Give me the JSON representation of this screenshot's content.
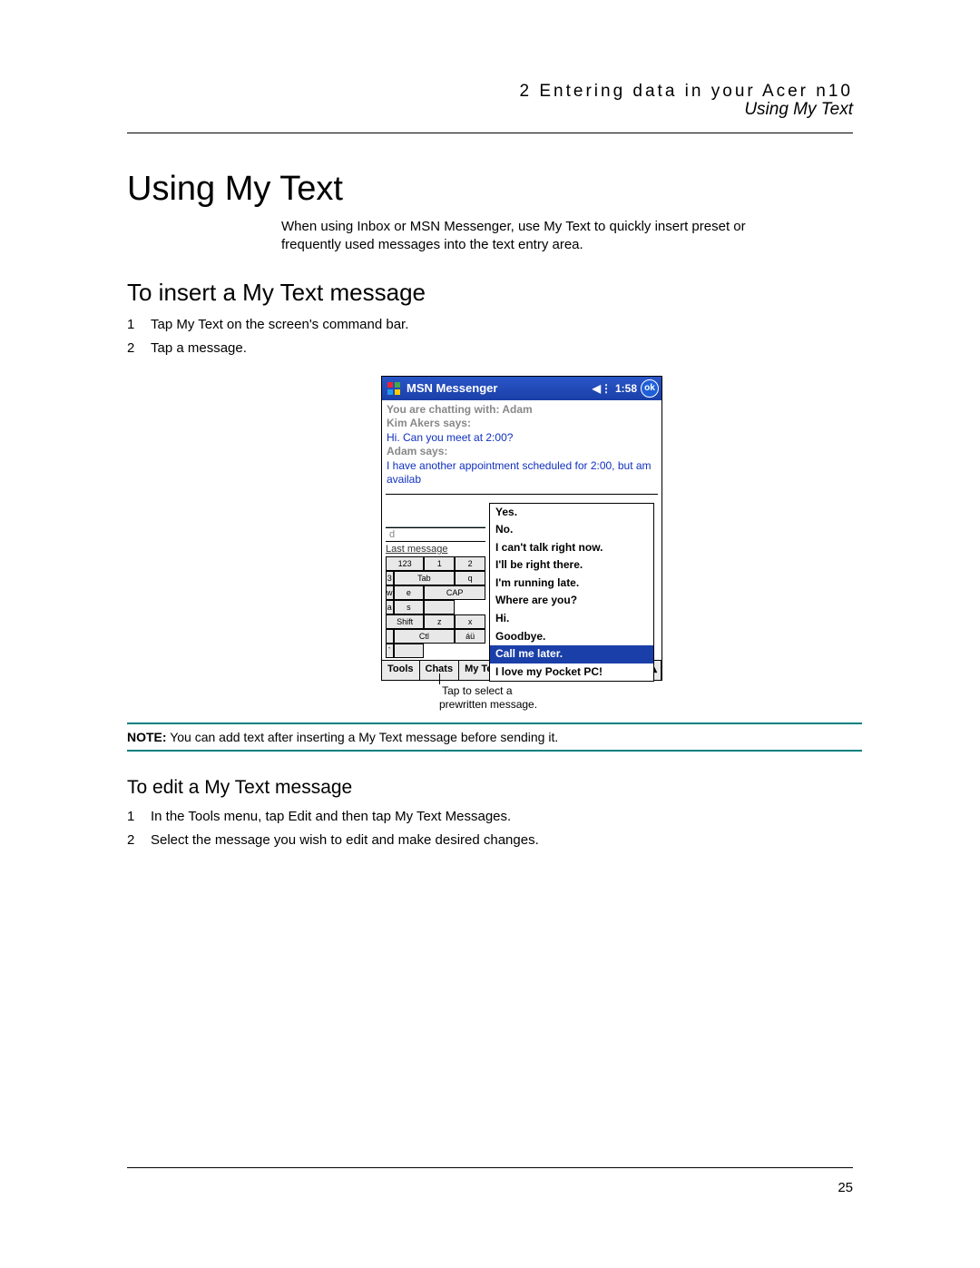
{
  "header": {
    "chapter": "2 Entering data in your Acer n10",
    "section": "Using My Text"
  },
  "h1": "Using My Text",
  "intro": "When using Inbox or MSN Messenger, use My Text to quickly insert preset or frequently used messages into the text entry area.",
  "h2_insert": "To insert a My Text message",
  "steps_insert": [
    "Tap My Text on the screen's command bar.",
    "Tap a message."
  ],
  "screenshot_caption": {
    "line1": "Tap to select a",
    "line2": "prewritten message."
  },
  "note_label": "NOTE:",
  "note_text": "You can add text after inserting a My Text message before sending it.",
  "h3_edit": "To edit a My Text message",
  "steps_edit": [
    "In the Tools menu, tap Edit and then tap My Text Messages.",
    "Select the message you wish to edit and make desired changes."
  ],
  "page_number": "25",
  "device": {
    "title": "MSN Messenger",
    "time": "1:58",
    "ok": "ok",
    "chat_meta1": "You are chatting with: Adam",
    "chat_meta2": "Kim Akers says:",
    "chat_msg1": "Hi. Can you meet at 2:00?",
    "chat_meta3": "Adam says:",
    "chat_msg2": "I have another appointment scheduled for 2:00, but am availab",
    "send_label_left": "Last message",
    "send_label_right": "d",
    "mytext_items": [
      "Yes.",
      "No.",
      "I can't talk right now.",
      "I'll be right there.",
      "I'm running late.",
      "Where are you?",
      "Hi.",
      "Goodbye.",
      "Call me later.",
      "I love my Pocket PC!"
    ],
    "mytext_selected_index": 8,
    "kbd_rows": [
      [
        "123",
        "1",
        "2",
        "3"
      ],
      [
        "Tab",
        "q",
        "w",
        "e"
      ],
      [
        "CAP",
        "a",
        "s",
        ""
      ],
      [
        "Shift",
        "z",
        "x",
        ""
      ],
      [
        "Ctl",
        "áü",
        "`",
        ""
      ]
    ],
    "cmdbar": {
      "tools": "Tools",
      "chats": "Chats",
      "mytext": "My Text"
    }
  }
}
